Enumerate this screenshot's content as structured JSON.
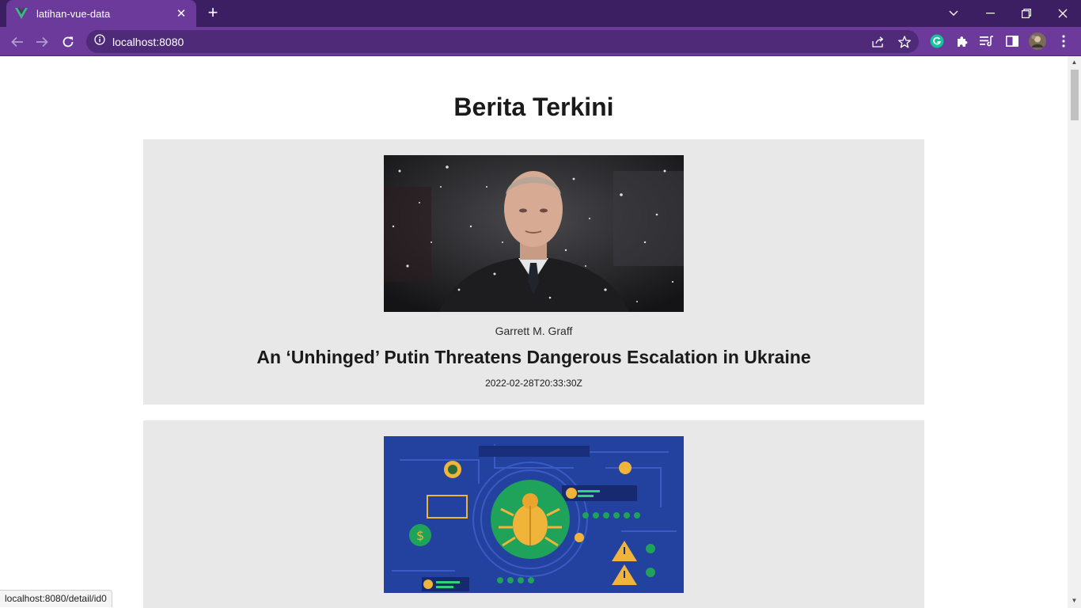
{
  "browser": {
    "tab_title": "latihan-vue-data",
    "url": "localhost:8080",
    "status_url": "localhost:8080/detail/id0",
    "theme_color": "#6b3a9a",
    "tabstrip_color": "#3c1f63"
  },
  "page": {
    "title": "Berita Terkini",
    "articles": [
      {
        "author": "Garrett M. Graff",
        "title": "An ‘Unhinged’ Putin Threatens Dangerous Escalation in Ukraine",
        "published_at": "2022-02-28T20:33:30Z",
        "image_icon": "portrait-in-snow-photo"
      },
      {
        "author": "",
        "title": "",
        "published_at": "",
        "image_icon": "bug-circuit-illustration"
      }
    ]
  }
}
